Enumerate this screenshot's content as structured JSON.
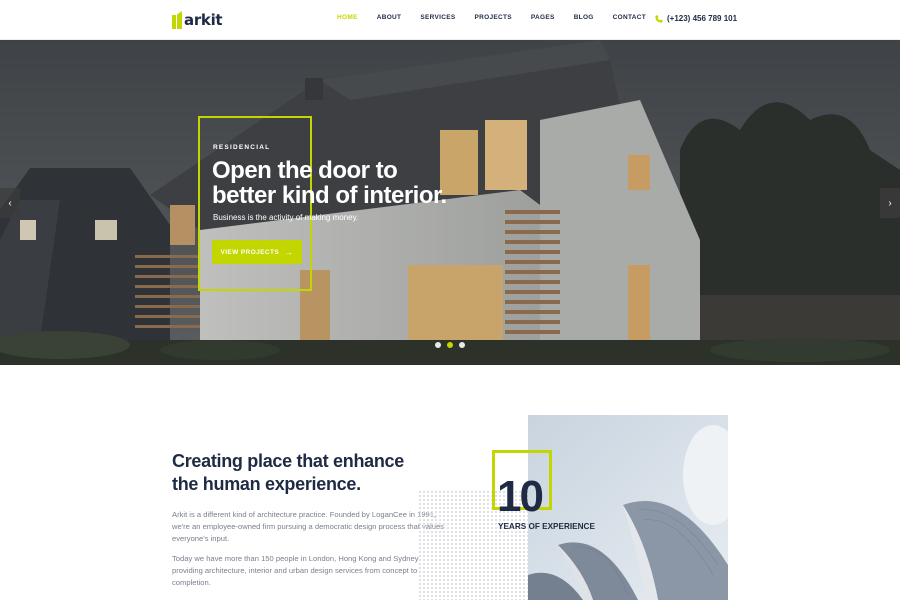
{
  "brand": {
    "name": "arkit",
    "accent": "#c4d600",
    "dark": "#1f2a44"
  },
  "nav": {
    "items": [
      "HOME",
      "ABOUT",
      "SERVICES",
      "PROJECTS",
      "PAGES",
      "BLOG",
      "CONTACT"
    ],
    "active": "HOME"
  },
  "contact": {
    "phone": "(+123) 456 789 101",
    "icon": "phone-icon"
  },
  "hero": {
    "eyebrow": "RESIDENCIAL",
    "title_line1": "Open the door to",
    "title_line2": "better kind of interior.",
    "subtitle": "Business is the activity of making money.",
    "cta": "VIEW PROJECTS",
    "cta_icon": "arrow-right-icon",
    "prev_icon": "chevron-left-icon",
    "next_icon": "chevron-right-icon",
    "slides_count": 3,
    "active_slide": 2
  },
  "about": {
    "title_line1": "Creating place that enhance",
    "title_line2": "the human experience.",
    "paragraph1": "Arkit is a different kind of architecture practice. Founded by LoganCee in 1991, we're an employee-owned firm pursuing a democratic design process that values everyone's input.",
    "paragraph2": "Today we have more than 150 people in London, Hong Kong and Sydney providing architecture, interior and urban design services from concept to completion.",
    "experience_number": "10",
    "experience_label": "YEARS OF EXPERIENCE"
  }
}
